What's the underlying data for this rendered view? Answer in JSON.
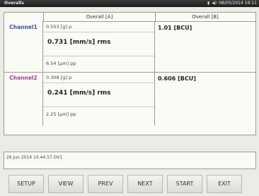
{
  "titlebar": {
    "title": "Overalls",
    "icons": [
      "battery-icon",
      "speaker-icon"
    ],
    "datetime": "08/05/2014 16:11"
  },
  "table": {
    "header_a": "Overall [A]",
    "header_b": "Overall [B]",
    "rows": [
      {
        "channel": "Channel1",
        "a_line1": "0.553 [g] p",
        "a_line2": "0.731 [mm/s] rms",
        "a_line3": "6.54 [μm] pp",
        "b_value": "1.01 [BCU]"
      },
      {
        "channel": "Channel2",
        "a_line1": "0.308 [g] p",
        "a_line2": "0.241 [mm/s] rms",
        "a_line3": "2.25 [μm] pp",
        "b_value": "0.606 [BCU]"
      }
    ]
  },
  "file": {
    "name": "26 Jun 2014 10.44.57.OV1"
  },
  "buttons": [
    "SETUP",
    "VIEW",
    "PREV",
    "NEXT",
    "START",
    "EXIT"
  ]
}
